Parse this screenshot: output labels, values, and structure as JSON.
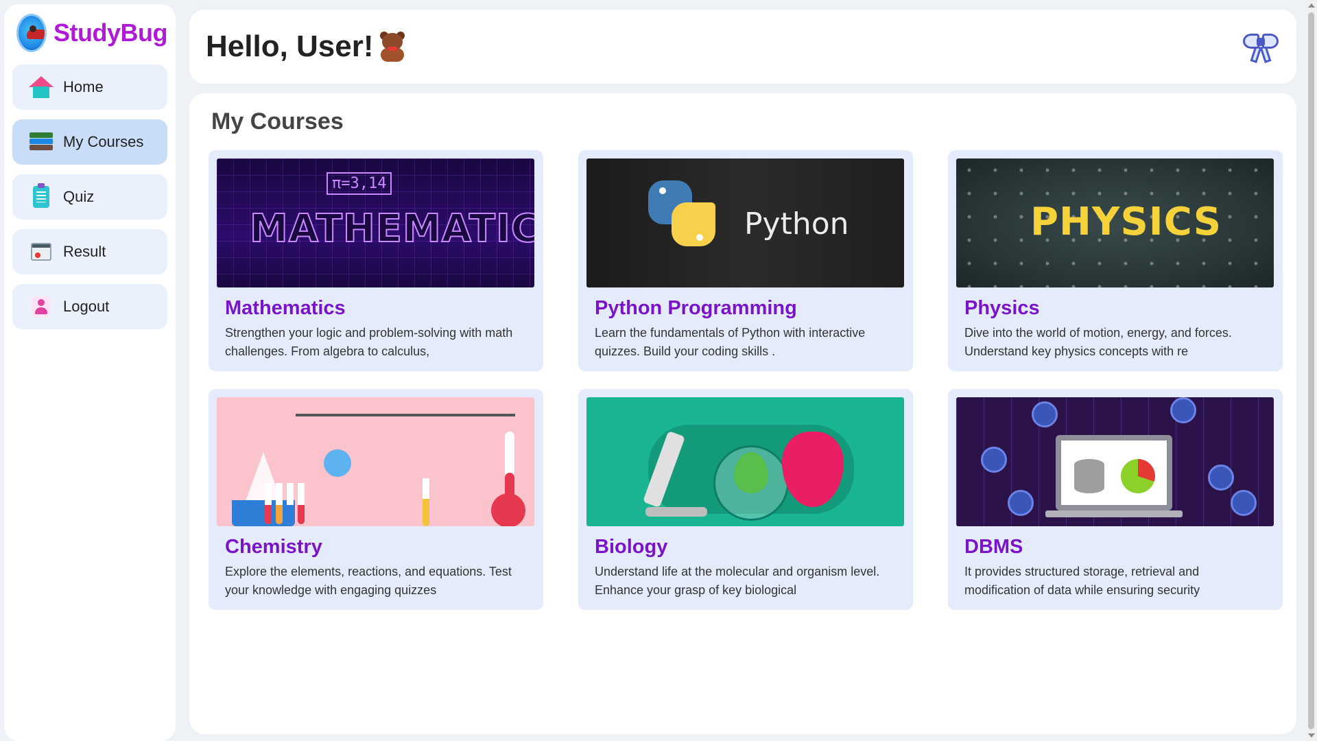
{
  "brand": {
    "name": "StudyBug",
    "logo_icon": "ladybug-globe-icon"
  },
  "sidebar": {
    "items": [
      {
        "label": "Home",
        "icon": "home-icon",
        "active": false
      },
      {
        "label": "My Courses",
        "icon": "books-icon",
        "active": true
      },
      {
        "label": "Quiz",
        "icon": "clipboard-icon",
        "active": false
      },
      {
        "label": "Result",
        "icon": "result-icon",
        "active": false
      },
      {
        "label": "Logout",
        "icon": "user-logout-icon",
        "active": false
      }
    ]
  },
  "header": {
    "greeting": "Hello, User!",
    "greeting_icon": "teddy-bear-icon",
    "action_icon": "ribbon-bow-icon"
  },
  "main": {
    "title": "My Courses",
    "courses": [
      {
        "title": "Mathematics",
        "description": "Strengthen your logic and problem-solving with math challenges. From algebra to calculus,",
        "image_text": "MATHEMATICS"
      },
      {
        "title": "Python Programming",
        "description": "Learn the fundamentals of Python with interactive quizzes. Build your coding skills .",
        "image_text": "Python"
      },
      {
        "title": "Physics",
        "description": "Dive into the world of motion, energy, and forces. Understand key physics concepts with re",
        "image_text": "PHYSICS"
      },
      {
        "title": "Chemistry",
        "description": "Explore the elements, reactions, and equations. Test your knowledge with engaging quizzes",
        "image_text": ""
      },
      {
        "title": "Biology",
        "description": "Understand life at the molecular and organism level. Enhance your grasp of key biological",
        "image_text": ""
      },
      {
        "title": "DBMS",
        "description": "It provides structured storage, retrieval and modification of data while ensuring security",
        "image_text": ""
      }
    ]
  },
  "colors": {
    "brand": "#b01ad6",
    "course_title": "#7a14c9",
    "card_bg": "#e4ecfb",
    "nav_bg": "#eaf1fd",
    "nav_active_bg": "#c9dcf8"
  }
}
